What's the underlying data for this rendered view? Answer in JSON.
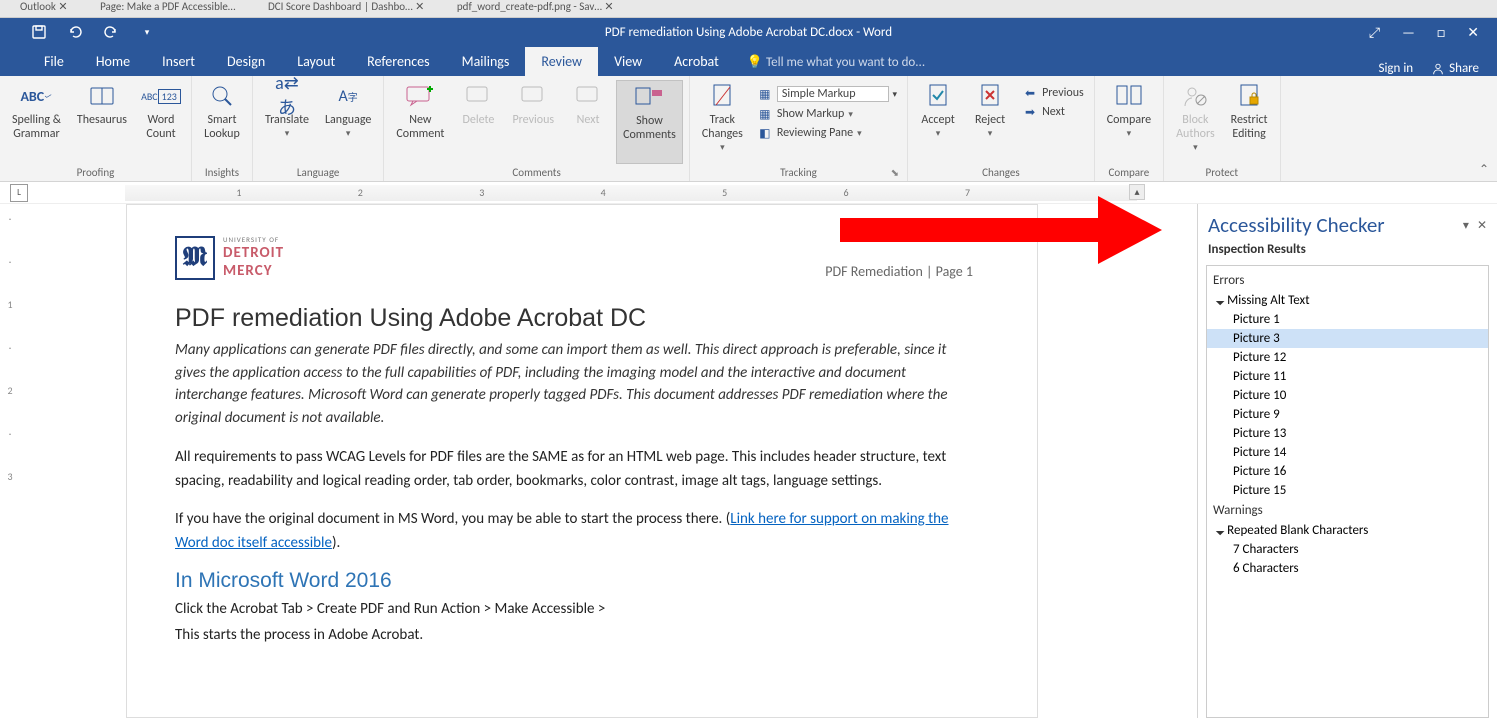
{
  "browser_tabs": [
    "Outlook  ✕",
    "Page: Make a PDF Accessible…",
    "DCI Score Dashboard | Dashbo…  ✕",
    "pdf_word_create-pdf.png - Sav…  ✕"
  ],
  "title": "PDF remediation Using Adobe Acrobat DC.docx - Word",
  "win": {
    "touch": "⤢",
    "min": "—",
    "max": "□",
    "close": "✕"
  },
  "menu": {
    "items": [
      "File",
      "Home",
      "Insert",
      "Design",
      "Layout",
      "References",
      "Mailings",
      "Review",
      "View",
      "Acrobat"
    ],
    "active": "Review",
    "tell_me": "Tell me what you want to do...",
    "signin": "Sign in",
    "share": "Share"
  },
  "ribbon": {
    "proofing": {
      "spelling": "Spelling &\nGrammar",
      "thesaurus": "Thesaurus",
      "word_count": "Word\nCount",
      "label": "Proofing"
    },
    "insights": {
      "smart": "Smart\nLookup",
      "label": "Insights"
    },
    "language": {
      "translate": "Translate",
      "lang": "Language",
      "label": "Language"
    },
    "comments": {
      "new": "New\nComment",
      "delete": "Delete",
      "prev": "Previous",
      "next": "Next",
      "show": "Show\nComments",
      "label": "Comments"
    },
    "tracking": {
      "track": "Track\nChanges",
      "markup": "Simple Markup",
      "show_markup": "Show Markup",
      "reviewing": "Reviewing Pane",
      "label": "Tracking"
    },
    "changes": {
      "accept": "Accept",
      "reject": "Reject",
      "prev": "Previous",
      "next": "Next",
      "label": "Changes"
    },
    "compare": {
      "compare": "Compare",
      "label": "Compare"
    },
    "protect": {
      "block": "Block\nAuthors",
      "restrict": "Restrict\nEditing",
      "label": "Protect"
    }
  },
  "ruler": {
    "l": "L",
    "nums": [
      "1",
      "2",
      "3",
      "4",
      "5",
      "6",
      "7"
    ]
  },
  "doc": {
    "logo_small": "UNIVERSITY OF",
    "logo1": "DETROIT",
    "logo2": "MERCY",
    "header_right": "PDF Remediation | Page 1",
    "h1": "PDF remediation Using Adobe Acrobat DC",
    "lead": "Many applications can generate PDF files directly, and some can import them as well. This direct approach is preferable, since it gives the application access to the full capabilities of PDF, including the imaging model and the interactive and document interchange features. Microsoft Word can generate properly tagged PDFs. This document addresses PDF remediation where the original document is not available.",
    "p2": "All requirements to pass WCAG Levels for PDF files are the SAME as for an HTML web page. This includes header structure, text spacing, readability and logical reading order, tab order, bookmarks, color contrast, image alt tags, language settings.",
    "p3a": "If you have the original document in MS Word, you may be able to start the process there. (",
    "p3_link": "Link here for support on making the Word doc itself accessible",
    "p3b": ").",
    "h2": "In Microsoft Word 2016",
    "p4": "Click the Acrobat Tab > Create PDF and Run Action > Make Accessible >",
    "p5": "This starts the process in Adobe Acrobat."
  },
  "acc": {
    "title": "Accessibility Checker",
    "subtitle": "Inspection Results",
    "errors_label": "Errors",
    "missing_alt": "Missing Alt Text",
    "alt_items": [
      "Picture 1",
      "Picture 3",
      "Picture 12",
      "Picture 11",
      "Picture 10",
      "Picture 9",
      "Picture 13",
      "Picture 14",
      "Picture 16",
      "Picture 15"
    ],
    "selected": "Picture 3",
    "warnings_label": "Warnings",
    "repeated": "Repeated Blank Characters",
    "warn_items": [
      "7 Characters",
      "6 Characters"
    ]
  }
}
